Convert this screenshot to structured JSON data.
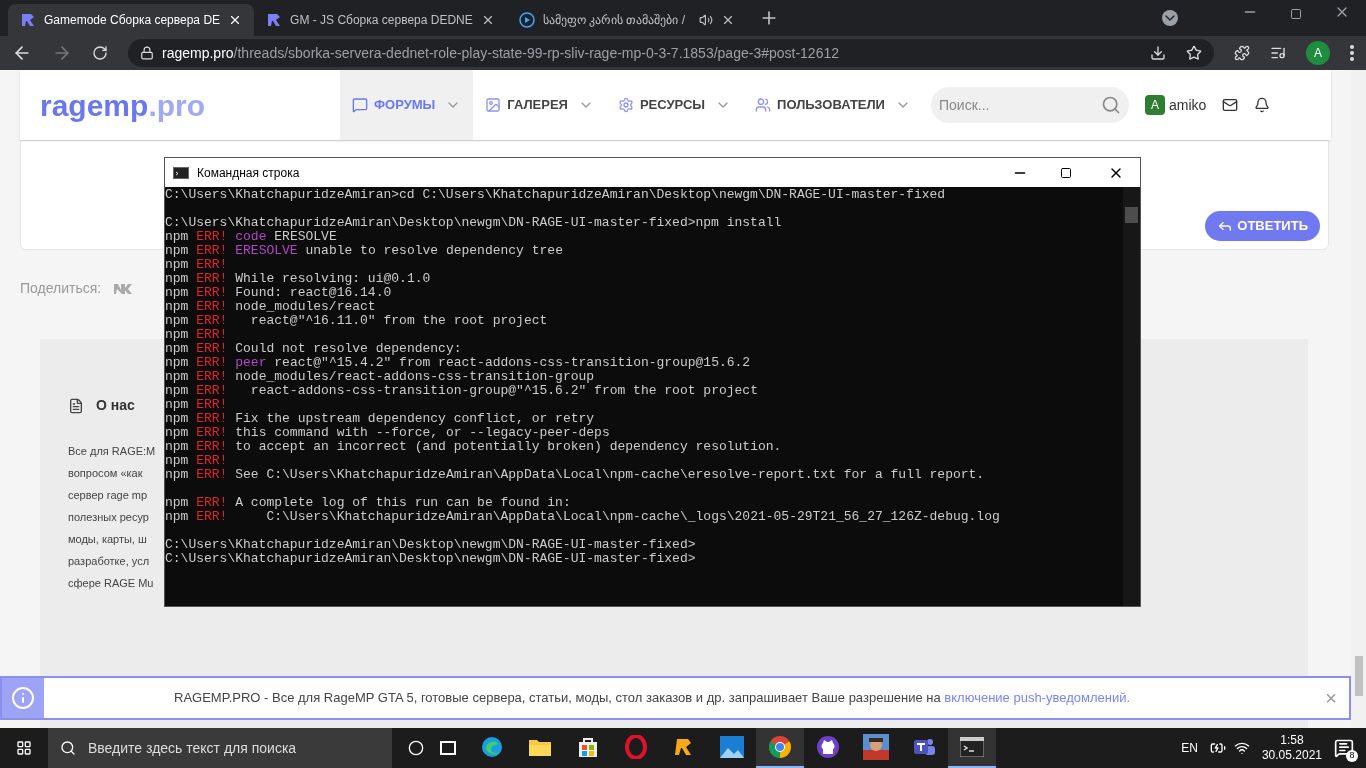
{
  "browser": {
    "tabs": [
      {
        "title": "Gamemode Сборка сервера DE",
        "selected": true,
        "kind": "site"
      },
      {
        "title": "GM - JS Сборка сервера DEDNE",
        "selected": false,
        "kind": "site"
      },
      {
        "title": "სამეფო კარის თამაშები /",
        "selected": false,
        "kind": "video"
      }
    ],
    "url_host": "ragemp.pro",
    "url_path": "/threads/sborka-servera-dednet-role-play-state-99-rp-sliv-rage-mp-0-3-7.1853/page-3#post-12612",
    "profile": "A"
  },
  "site": {
    "logo_main": "ragemp",
    "logo_tld": ".pro",
    "nav": [
      {
        "label": "ФОРУМЫ",
        "kind": "forums",
        "selected": true
      },
      {
        "label": "ГАЛЕРЕЯ",
        "kind": "gallery",
        "selected": false
      },
      {
        "label": "РЕСУРСЫ",
        "kind": "resources",
        "selected": false
      },
      {
        "label": "ПОЛЬЗОВАТЕЛИ",
        "kind": "users",
        "selected": false
      }
    ],
    "search_placeholder": "Поиск...",
    "user_initial": "A",
    "user_name": "amiko",
    "reply_button": "ОТВЕТИТЬ",
    "share_label": "Поделиться:",
    "about_title": "О нас",
    "about_lines": [
      "Все для RAGE:M",
      "вопросом «как",
      "сервер rage mp",
      "полезных ресур",
      "моды, карты, ш",
      "разработке, усл",
      "сфере RAGE Mu"
    ],
    "notice_text": "RAGEMP.PRO - Все для RageMP GTA 5, готовые сервера, статьи, моды, стол заказов и др. запрашивает Ваше разрешение на ",
    "notice_link": "включение push-уведомлений.",
    "notice_close": "×"
  },
  "console": {
    "title": "Командная строка",
    "lines": [
      {
        "kind": "prompt",
        "text": "C:\\Users\\KhatchapuridzeAmiran>cd C:\\Users\\KhatchapuridzeAmiran\\Desktop\\newgm\\DN-RAGE-UI-master-fixed"
      },
      {
        "kind": "blank"
      },
      {
        "kind": "prompt",
        "text": "C:\\Users\\KhatchapuridzeAmiran\\Desktop\\newgm\\DN-RAGE-UI-master-fixed>npm install"
      },
      {
        "kind": "error",
        "prefix": "npm",
        "tag": "ERR!",
        "keyword": "code",
        "text": "ERESOLVE"
      },
      {
        "kind": "error",
        "prefix": "npm",
        "tag": "ERR!",
        "keyword": "ERESOLVE",
        "text": "unable to resolve dependency tree"
      },
      {
        "kind": "error",
        "prefix": "npm",
        "tag": "ERR!"
      },
      {
        "kind": "error",
        "prefix": "npm",
        "tag": "ERR!",
        "text": "While resolving: ui@0.1.0"
      },
      {
        "kind": "error",
        "prefix": "npm",
        "tag": "ERR!",
        "text": "Found: react@16.14.0"
      },
      {
        "kind": "error",
        "prefix": "npm",
        "tag": "ERR!",
        "text": "node_modules/react"
      },
      {
        "kind": "error",
        "prefix": "npm",
        "tag": "ERR!",
        "text": "  react@\"^16.11.0\" from the root project"
      },
      {
        "kind": "error",
        "prefix": "npm",
        "tag": "ERR!"
      },
      {
        "kind": "error",
        "prefix": "npm",
        "tag": "ERR!",
        "text": "Could not resolve dependency:"
      },
      {
        "kind": "error",
        "prefix": "npm",
        "tag": "ERR!",
        "keyword": "peer",
        "text": "react@\"^15.4.2\" from react-addons-css-transition-group@15.6.2"
      },
      {
        "kind": "error",
        "prefix": "npm",
        "tag": "ERR!",
        "text": "node_modules/react-addons-css-transition-group"
      },
      {
        "kind": "error",
        "prefix": "npm",
        "tag": "ERR!",
        "text": "  react-addons-css-transition-group@\"^15.6.2\" from the root project"
      },
      {
        "kind": "error",
        "prefix": "npm",
        "tag": "ERR!"
      },
      {
        "kind": "error",
        "prefix": "npm",
        "tag": "ERR!",
        "text": "Fix the upstream dependency conflict, or retry"
      },
      {
        "kind": "error",
        "prefix": "npm",
        "tag": "ERR!",
        "text": "this command with --force, or --legacy-peer-deps"
      },
      {
        "kind": "error",
        "prefix": "npm",
        "tag": "ERR!",
        "text": "to accept an incorrect (and potentially broken) dependency resolution."
      },
      {
        "kind": "error",
        "prefix": "npm",
        "tag": "ERR!"
      },
      {
        "kind": "error",
        "prefix": "npm",
        "tag": "ERR!",
        "text": "See C:\\Users\\KhatchapuridzeAmiran\\AppData\\Local\\npm-cache\\eresolve-report.txt for a full report."
      },
      {
        "kind": "blank"
      },
      {
        "kind": "error",
        "prefix": "npm",
        "tag": "ERR!",
        "text": "A complete log of this run can be found in:"
      },
      {
        "kind": "error",
        "prefix": "npm",
        "tag": "ERR!",
        "text": "    C:\\Users\\KhatchapuridzeAmiran\\AppData\\Local\\npm-cache\\_logs\\2021-05-29T21_56_27_126Z-debug.log"
      },
      {
        "kind": "blank"
      },
      {
        "kind": "prompt",
        "text": "C:\\Users\\KhatchapuridzeAmiran\\Desktop\\newgm\\DN-RAGE-UI-master-fixed>"
      },
      {
        "kind": "prompt",
        "text": "C:\\Users\\KhatchapuridzeAmiran\\Desktop\\newgm\\DN-RAGE-UI-master-fixed>"
      }
    ]
  },
  "taskbar": {
    "search_placeholder": "Введите здесь текст для поиска",
    "apps": [
      {
        "kind": "edge",
        "active": false
      },
      {
        "kind": "folder",
        "active": false
      },
      {
        "kind": "store",
        "active": false
      },
      {
        "kind": "opera",
        "active": false
      },
      {
        "kind": "rage",
        "active": false
      },
      {
        "kind": "photos",
        "active": false
      },
      {
        "kind": "chrome",
        "active": true
      },
      {
        "kind": "github",
        "active": false
      },
      {
        "kind": "picture",
        "active": false
      },
      {
        "kind": "teams",
        "active": false
      },
      {
        "kind": "terminal",
        "active": true
      }
    ],
    "language": "EN",
    "time": "1:58",
    "date": "30.05.2021",
    "notifications": "8"
  }
}
